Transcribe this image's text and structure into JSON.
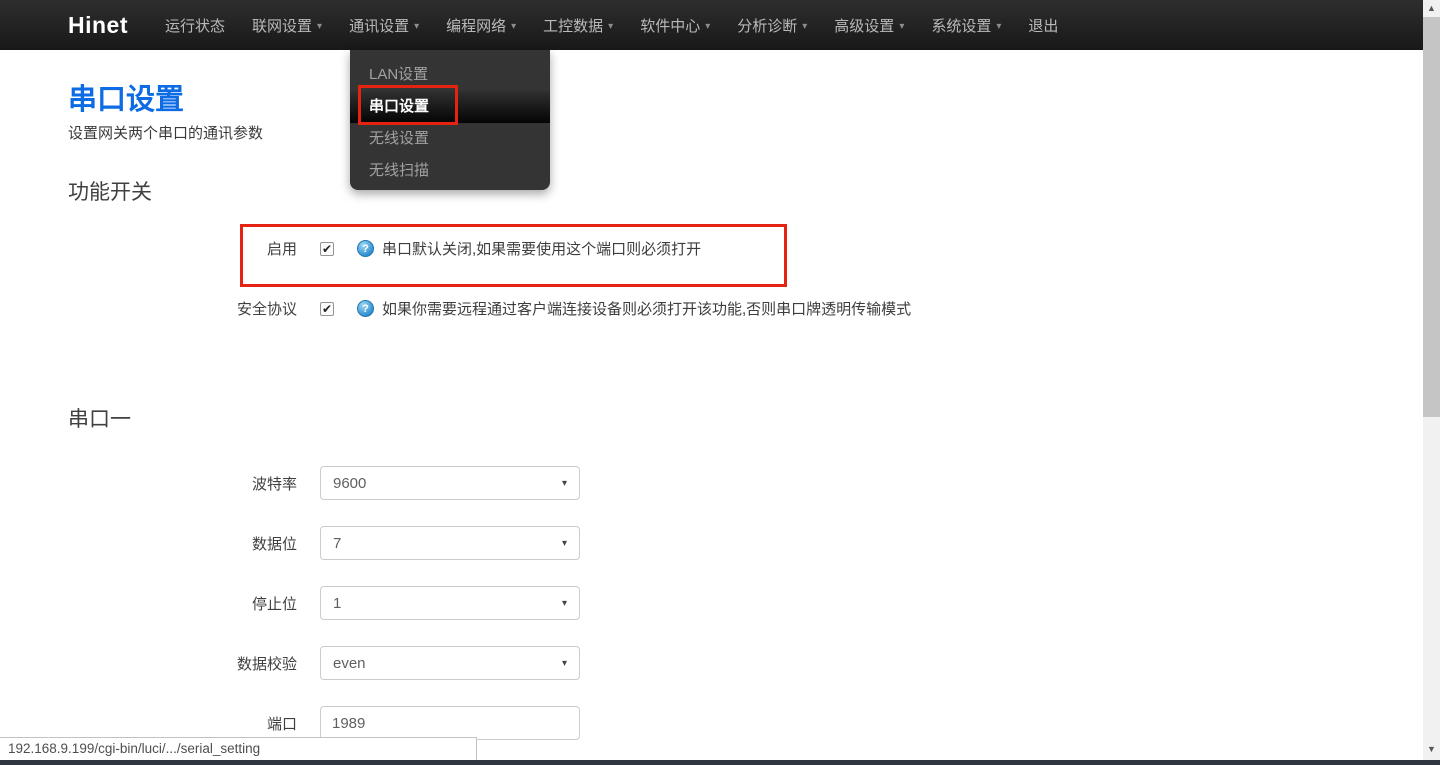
{
  "navbar": {
    "brand": "Hinet",
    "items": [
      {
        "label": "运行状态",
        "caret": false
      },
      {
        "label": "联网设置",
        "caret": true
      },
      {
        "label": "通讯设置",
        "caret": true,
        "active": true
      },
      {
        "label": "编程网络",
        "caret": true
      },
      {
        "label": "工控数据",
        "caret": true
      },
      {
        "label": "软件中心",
        "caret": true
      },
      {
        "label": "分析诊断",
        "caret": true
      },
      {
        "label": "高级设置",
        "caret": true
      },
      {
        "label": "系统设置",
        "caret": true
      },
      {
        "label": "退出",
        "caret": false
      }
    ]
  },
  "dropdown": {
    "parent": "通讯设置",
    "items": [
      {
        "label": "LAN设置",
        "active": false
      },
      {
        "label": "串口设置",
        "active": true,
        "annotated": true
      },
      {
        "label": "无线设置",
        "active": false
      },
      {
        "label": "无线扫描",
        "active": false
      }
    ]
  },
  "page": {
    "title": "串口设置",
    "subtitle": "设置网关两个串口的通讯参数",
    "switches": {
      "heading": "功能开关",
      "rows": [
        {
          "label": "启用",
          "checked": true,
          "check_glyph": "✔",
          "help_icon": "?",
          "help": "串口默认关闭,如果需要使用这个端口则必须打开",
          "annotated": true
        },
        {
          "label": "安全协议",
          "checked": true,
          "check_glyph": "✔",
          "help_icon": "?",
          "help": "如果你需要远程通过客户端连接设备则必须打开该功能,否则串口牌透明传输模式"
        }
      ]
    },
    "serial1": {
      "heading": "串口一",
      "fields": [
        {
          "label": "波特率",
          "value": "9600",
          "type": "select"
        },
        {
          "label": "数据位",
          "value": "7",
          "type": "select"
        },
        {
          "label": "停止位",
          "value": "1",
          "type": "select"
        },
        {
          "label": "数据校验",
          "value": "even",
          "type": "select"
        },
        {
          "label": "端口",
          "value": "1989",
          "type": "text"
        }
      ],
      "select_caret": "▾"
    }
  },
  "statusbar": {
    "url": "192.168.9.199/cgi-bin/luci/.../serial_setting"
  },
  "scrollbar": {
    "up_glyph": "▲",
    "down_glyph": "▼"
  },
  "colors": {
    "accent_blue": "#0d6ce4",
    "annotation_red": "#e42313",
    "navbar_bg": "#222222",
    "dropdown_bg": "#343434",
    "bottom_strip": "#2f3640",
    "help_icon_blue": "#2f8fd0"
  }
}
